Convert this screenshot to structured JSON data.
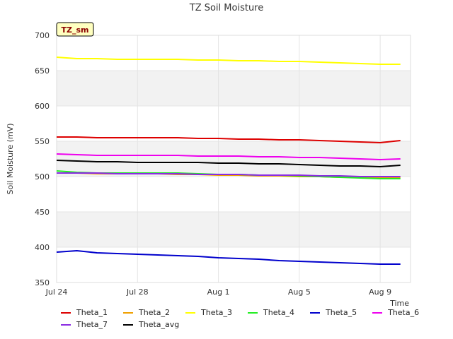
{
  "chart_data": {
    "type": "line",
    "title": "TZ Soil Moisture",
    "badge": "TZ_sm",
    "xlabel": "Time",
    "ylabel": "Soil Moisture (mV)",
    "ylim": [
      350,
      700
    ],
    "yticks": [
      350,
      400,
      450,
      500,
      550,
      600,
      650,
      700
    ],
    "xlim": [
      "2024-07-24",
      "2024-08-10"
    ],
    "xticks": [
      {
        "date": "2024-07-24",
        "label": "Jul 24"
      },
      {
        "date": "2024-07-28",
        "label": "Jul 28"
      },
      {
        "date": "2024-08-01",
        "label": "Aug 1"
      },
      {
        "date": "2024-08-05",
        "label": "Aug 5"
      },
      {
        "date": "2024-08-09",
        "label": "Aug 9"
      }
    ],
    "x": [
      "2024-07-24",
      "2024-07-25",
      "2024-07-26",
      "2024-07-27",
      "2024-07-28",
      "2024-07-29",
      "2024-07-30",
      "2024-07-31",
      "2024-08-01",
      "2024-08-02",
      "2024-08-03",
      "2024-08-04",
      "2024-08-05",
      "2024-08-06",
      "2024-08-07",
      "2024-08-08",
      "2024-08-09",
      "2024-08-10"
    ],
    "series": [
      {
        "name": "Theta_1",
        "color": "#dd0000",
        "values": [
          556,
          556,
          555,
          555,
          555,
          555,
          555,
          554,
          554,
          553,
          553,
          552,
          552,
          551,
          550,
          549,
          548,
          551
        ]
      },
      {
        "name": "Theta_2",
        "color": "#f0a000",
        "values": [
          505,
          505,
          504,
          504,
          504,
          504,
          503,
          503,
          502,
          502,
          501,
          501,
          500,
          500,
          499,
          499,
          498,
          499
        ]
      },
      {
        "name": "Theta_3",
        "color": "#ffff00",
        "values": [
          669,
          667,
          667,
          666,
          666,
          666,
          666,
          665,
          665,
          664,
          664,
          663,
          663,
          662,
          661,
          660,
          659,
          659
        ]
      },
      {
        "name": "Theta_4",
        "color": "#22ee22",
        "values": [
          508,
          506,
          505,
          505,
          505,
          505,
          505,
          504,
          503,
          503,
          502,
          502,
          501,
          500,
          499,
          498,
          497,
          497
        ]
      },
      {
        "name": "Theta_5",
        "color": "#0000cc",
        "values": [
          393,
          395,
          392,
          391,
          390,
          389,
          388,
          387,
          385,
          384,
          383,
          381,
          380,
          379,
          378,
          377,
          376,
          376
        ]
      },
      {
        "name": "Theta_6",
        "color": "#ee00ee",
        "values": [
          532,
          531,
          530,
          530,
          530,
          530,
          530,
          529,
          529,
          529,
          528,
          528,
          527,
          527,
          526,
          525,
          524,
          525
        ]
      },
      {
        "name": "Theta_7",
        "color": "#8a2be2",
        "values": [
          505,
          505,
          505,
          504,
          504,
          504,
          504,
          503,
          503,
          503,
          502,
          502,
          502,
          501,
          501,
          500,
          500,
          500
        ]
      },
      {
        "name": "Theta_avg",
        "color": "#000000",
        "values": [
          523,
          522,
          521,
          521,
          520,
          520,
          520,
          520,
          519,
          519,
          518,
          518,
          517,
          516,
          515,
          515,
          514,
          516
        ]
      }
    ]
  }
}
